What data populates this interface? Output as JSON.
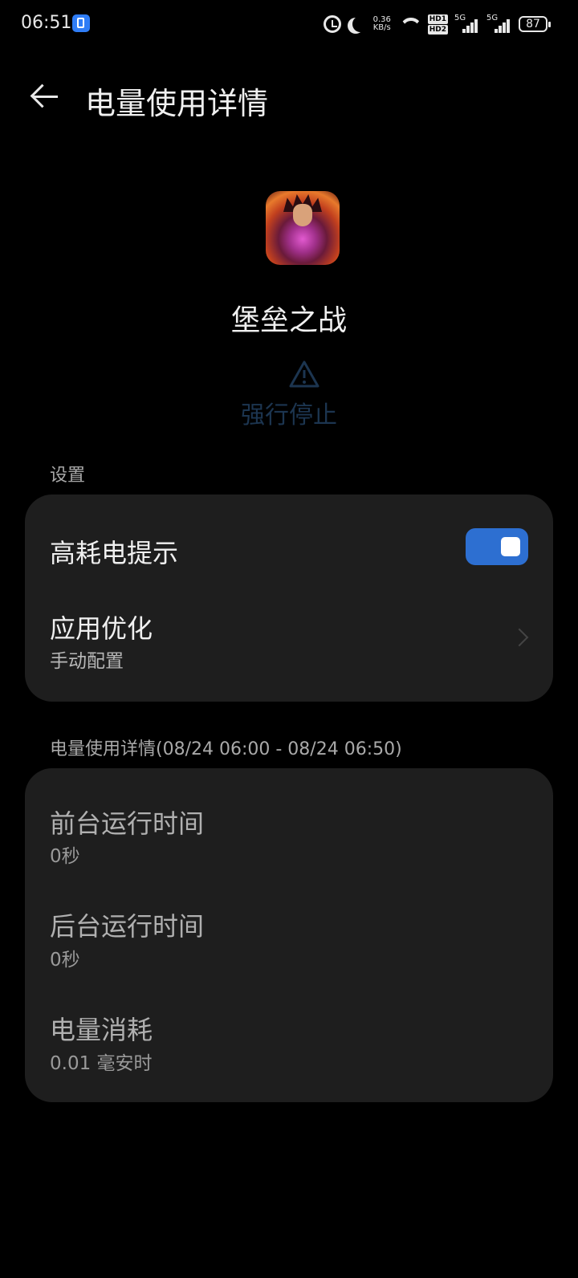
{
  "status_bar": {
    "time": "06:51",
    "net_speed_value": "0.36",
    "net_speed_unit": "KB/s",
    "hd1": "HD1",
    "hd2": "HD2",
    "sig1_label": "5G",
    "sig2_label": "5G",
    "battery": "87",
    "icons": [
      "app-notification-icon",
      "alarm-icon",
      "moon-icon",
      "wifi-icon",
      "signal-icon",
      "battery-icon"
    ]
  },
  "header": {
    "title": "电量使用详情"
  },
  "app": {
    "name": "堡垒之战",
    "force_stop_label": "强行停止"
  },
  "settings": {
    "section_label": "设置",
    "high_power_alert": {
      "label": "高耗电提示",
      "enabled": true
    },
    "app_optimization": {
      "label": "应用优化",
      "value": "手动配置"
    }
  },
  "usage": {
    "section_label": "电量使用详情(08/24 06:00 - 08/24 06:50)",
    "foreground": {
      "label": "前台运行时间",
      "value": "0秒"
    },
    "background": {
      "label": "后台运行时间",
      "value": "0秒"
    },
    "consumption": {
      "label": "电量消耗",
      "value": "0.01 毫安时"
    }
  },
  "colors": {
    "accent": "#2d6fd1",
    "card": "#1e1e1e",
    "background": "#000000",
    "force_stop": "#1c3550"
  }
}
